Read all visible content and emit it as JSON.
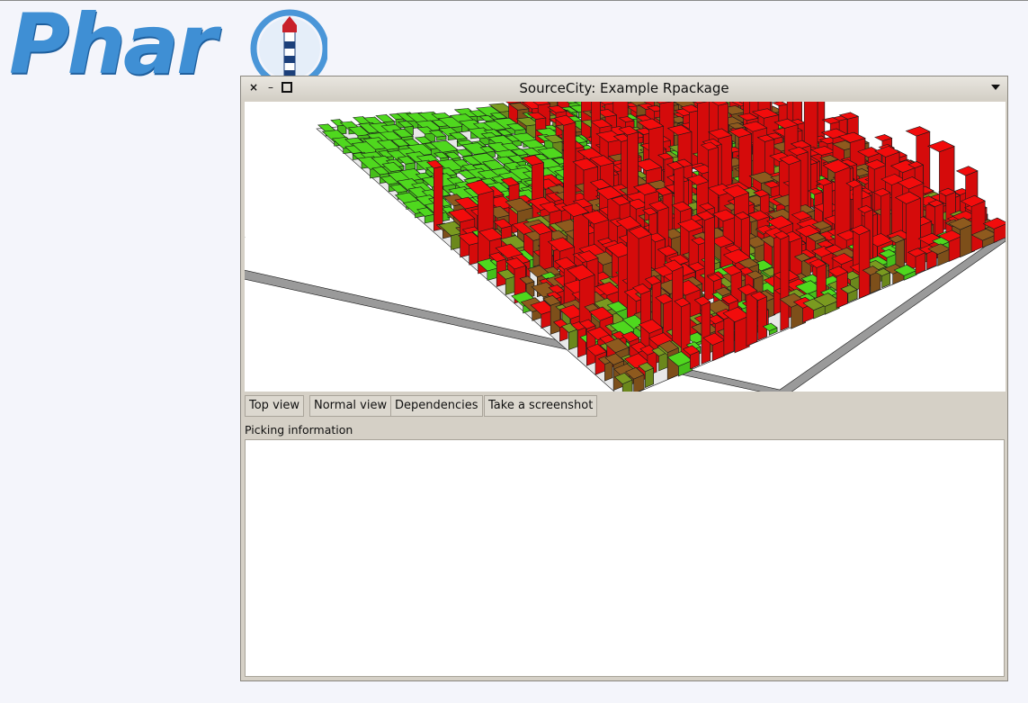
{
  "logo": {
    "text": "Phar"
  },
  "window": {
    "title": "SourceCity: Example Rpackage",
    "controls": {
      "close": "×",
      "minimize": "–"
    }
  },
  "toolbar": {
    "buttons": [
      "Top view",
      "Normal view",
      "Dependencies",
      "Take a screenshot"
    ]
  },
  "picking": {
    "label": "Picking information",
    "content": ""
  },
  "city": {
    "colors": {
      "hot": "#f20c0c",
      "warm": "#8e5a1e",
      "mild": "#7a9a20",
      "cool": "#4fd81e",
      "base": "#9a9a9a"
    }
  }
}
